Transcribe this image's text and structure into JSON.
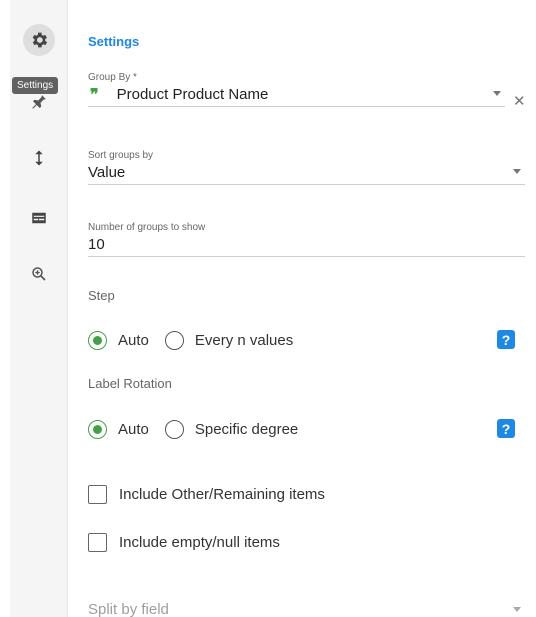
{
  "rail": {
    "tooltip": "Settings",
    "buttons": [
      {
        "icon": "gear-icon"
      },
      {
        "icon": "pin-icon"
      },
      {
        "icon": "vertical-arrows-icon"
      },
      {
        "icon": "subtitles-icon"
      },
      {
        "icon": "zoom-in-icon"
      }
    ]
  },
  "panel": {
    "title": "Settings",
    "group_by": {
      "label": "Group By *",
      "value": "Product Product Name",
      "icon": "quote-icon"
    },
    "sort_groups": {
      "label": "Sort groups by",
      "value": "Value"
    },
    "num_groups": {
      "label": "Number of groups to show",
      "value": "10"
    },
    "step": {
      "title": "Step",
      "options": [
        "Auto",
        "Every n values"
      ],
      "selected": "Auto"
    },
    "label_rotation": {
      "title": "Label Rotation",
      "options": [
        "Auto",
        "Specific degree"
      ],
      "selected": "Auto"
    },
    "include_other": {
      "label": "Include Other/Remaining items",
      "checked": false
    },
    "include_empty": {
      "label": "Include empty/null items",
      "checked": false
    },
    "split_by": {
      "placeholder": "Split by field"
    },
    "help_symbol": "?"
  },
  "colors": {
    "accent": "#1e88e5",
    "radio_selected": "#43a047"
  }
}
